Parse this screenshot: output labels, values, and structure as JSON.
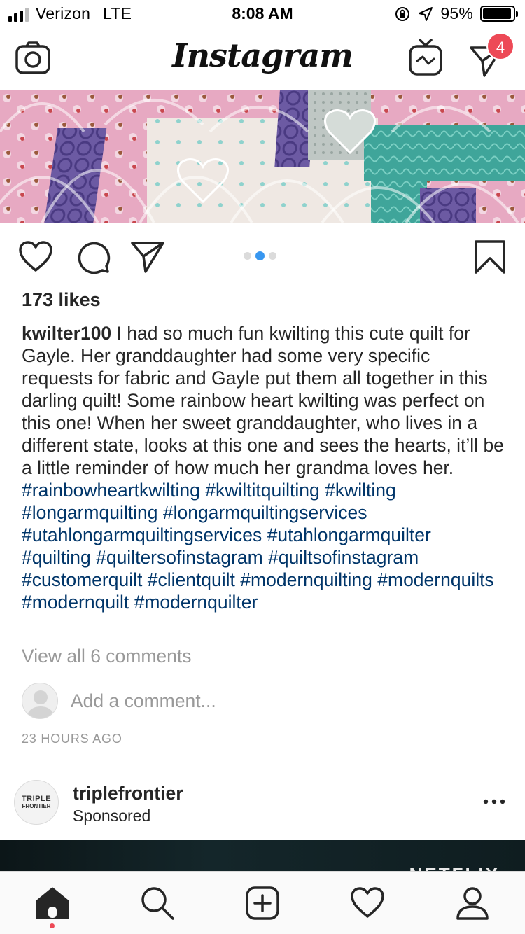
{
  "status_bar": {
    "carrier": "Verizon",
    "network": "LTE",
    "time": "8:08 AM",
    "battery": "95%",
    "battery_level": 0.95
  },
  "nav": {
    "logo": "Instagram",
    "direct_badge": "4",
    "icons": [
      "camera-icon",
      "igtv-icon",
      "direct-message-icon"
    ]
  },
  "post": {
    "carousel_dots": 3,
    "carousel_active": 1,
    "likes": "173 likes",
    "username": "kwilter100",
    "caption": " I had so much fun kwilting this cute quilt for Gayle.  Her granddaughter had some very specific requests for fabric and Gayle put them all together in this darling quilt!  Some rainbow heart kwilting was perfect on this one!  When her sweet granddaughter, who lives in a different state, looks at this one and sees the hearts, it’ll be a little reminder of how much her grandma loves her.",
    "hashtags": [
      "#rainbowheartkwilting",
      "#kwiltitquilting",
      "#kwilting",
      "#longarmquilting",
      "#longarmquiltingservices",
      "#utahlongarmquiltingservices",
      "#utahlongarmquilter",
      "#quilting",
      "#quiltersofinstagram",
      "#quiltsofinstagram",
      "#customerquilt",
      "#clientquilt",
      "#modernquilting",
      "#modernquilts",
      "#modernquilt",
      "#modernquilter"
    ],
    "view_comments": "View all 6 comments",
    "add_comment_placeholder": "Add a comment...",
    "timestamp": "23 HOURS AGO"
  },
  "next_post": {
    "username": "triplefrontier",
    "subtitle": "Sponsored",
    "avatar_logo_line1": "TRIPLE",
    "avatar_logo_line2": "FRONTIER",
    "image_text": "NETFLIX"
  },
  "tab_bar": {
    "items": [
      "home-icon",
      "search-icon",
      "new-post-icon",
      "activity-icon",
      "profile-icon"
    ],
    "active": "home"
  },
  "colors": {
    "hashtag": "#003569",
    "badge": "#ed4956",
    "carousel_active": "#3897f0",
    "muted_text": "#999999"
  }
}
